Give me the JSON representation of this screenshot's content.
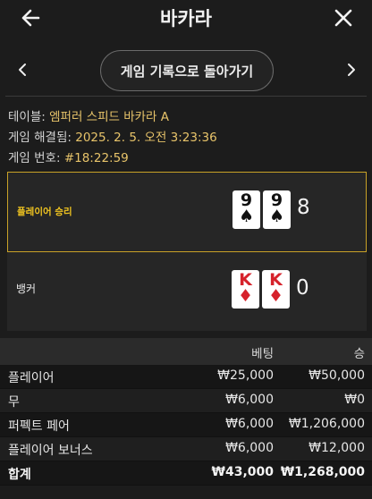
{
  "header": {
    "title": "바카라",
    "back_icon": "arrow-left-icon",
    "close_icon": "close-icon"
  },
  "nav": {
    "history_button": "게임 기록으로 돌아가기"
  },
  "info": {
    "table_label": "테이블: ",
    "table_value": "엠퍼러 스피드 바카라 A",
    "resolved_label": "게임 해결됨: ",
    "resolved_value": "2025. 2. 5. 오전 3:23:36",
    "round_label": "게임 번호: ",
    "round_value": "#18:22:59"
  },
  "hands": {
    "player": {
      "label": "플레이어 승리",
      "cards": [
        {
          "rank": "9",
          "suit": "♠",
          "color": "#111111"
        },
        {
          "rank": "9",
          "suit": "♠",
          "color": "#111111"
        }
      ],
      "score": "8"
    },
    "banker": {
      "label": "뱅커",
      "cards": [
        {
          "rank": "K",
          "suit": "♦",
          "color": "#d6222b"
        },
        {
          "rank": "K",
          "suit": "♦",
          "color": "#d6222b"
        }
      ],
      "score": "0"
    }
  },
  "table": {
    "headers": {
      "bet": "베팅",
      "win": "승"
    },
    "rows": [
      {
        "name": "플레이어",
        "bet": "₩25,000",
        "win": "₩50,000"
      },
      {
        "name": "무",
        "bet": "₩6,000",
        "win": "₩0"
      },
      {
        "name": "퍼펙트 페어",
        "bet": "₩6,000",
        "win": "₩1,206,000"
      },
      {
        "name": "플레이어 보너스",
        "bet": "₩6,000",
        "win": "₩12,000"
      }
    ],
    "total": {
      "name": "합계",
      "bet": "₩43,000",
      "win": "₩1,268,000"
    }
  },
  "colors": {
    "accent": "#c9a227",
    "highlight_text": "#e8c46a",
    "background": "#1c1c1c"
  }
}
